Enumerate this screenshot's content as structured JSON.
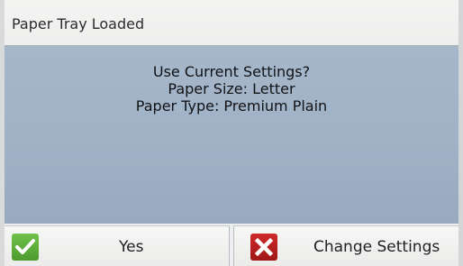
{
  "header": {
    "title": "Paper Tray Loaded"
  },
  "dialog": {
    "question": "Use Current Settings?",
    "paper_size": "Paper Size: Letter",
    "paper_type": "Paper Type: Premium Plain"
  },
  "buttons": {
    "yes_label": "Yes",
    "yes_icon": "checkmark-icon",
    "change_label": "Change Settings",
    "change_icon": "x-icon"
  },
  "colors": {
    "header_bg": "#f1f1f0",
    "panel_bg": "#a2b3c7",
    "yes_icon_bg": "#5aab38",
    "change_icon_bg": "#b91f1f"
  }
}
